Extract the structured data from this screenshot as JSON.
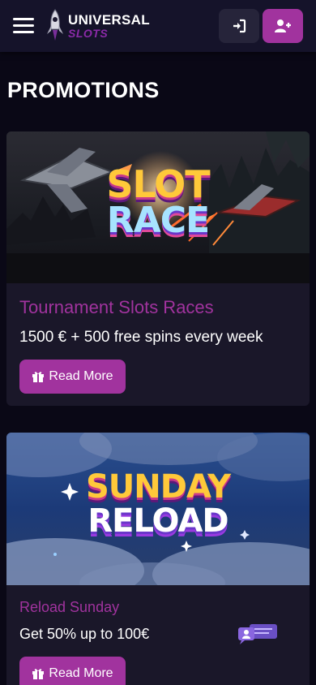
{
  "header": {
    "logo_line1": "UNIVERSAL",
    "logo_line2": "SLOTS"
  },
  "page": {
    "title": "PROMOTIONS"
  },
  "promotions": [
    {
      "banner_line1": "SLOT",
      "banner_line2": "RACE",
      "title": "Tournament Slots Races",
      "subtitle": "1500 € + 500 free spins every week",
      "button_label": "Read More"
    },
    {
      "banner_line1": "SUNDAY",
      "banner_line2": "RELOAD",
      "title": "Reload Sunday",
      "subtitle": "Get 50% up to 100€",
      "button_label": "Read More"
    }
  ],
  "colors": {
    "background": "#0a0816",
    "header": "#15132a",
    "accent": "#a1339e",
    "card": "#1a1729"
  },
  "icons": [
    "menu-icon",
    "rocket-logo-icon",
    "sign-in-icon",
    "user-plus-icon",
    "gift-icon",
    "chat-icon"
  ]
}
